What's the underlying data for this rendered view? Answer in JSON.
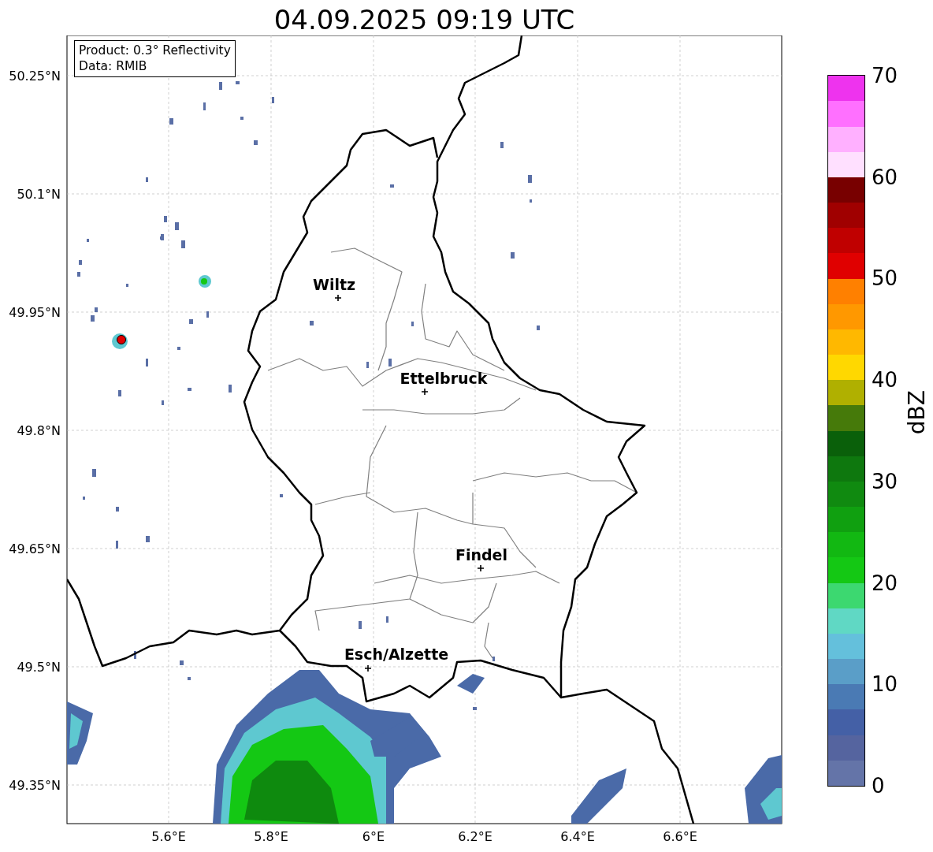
{
  "title": "04.09.2025 09:19 UTC",
  "info_box": [
    "Product: 0.3° Reflectivity",
    "Data: RMIB"
  ],
  "lat_ticks": [
    "50.25°N",
    "50.1°N",
    "49.95°N",
    "49.8°N",
    "49.65°N",
    "49.5°N",
    "49.35°N"
  ],
  "lon_ticks": [
    "5.6°E",
    "5.8°E",
    "6°E",
    "6.2°E",
    "6.4°E",
    "6.6°E"
  ],
  "cities": [
    {
      "name": "Wiltz"
    },
    {
      "name": "Ettelbruck"
    },
    {
      "name": "Findel"
    },
    {
      "name": "Esch/Alzette"
    }
  ],
  "colorbar": {
    "label": "dBZ",
    "ticks": [
      "70",
      "60",
      "50",
      "40",
      "30",
      "20",
      "10",
      "0"
    ],
    "segments": [
      {
        "color": "#6474a8"
      },
      {
        "color": "#55649f"
      },
      {
        "color": "#4460a6"
      },
      {
        "color": "#4a7ab4"
      },
      {
        "color": "#5a9ec8"
      },
      {
        "color": "#64c0dc"
      },
      {
        "color": "#60d8c4"
      },
      {
        "color": "#3cd870"
      },
      {
        "color": "#14c814"
      },
      {
        "color": "#12b812"
      },
      {
        "color": "#10a010"
      },
      {
        "color": "#108a10"
      },
      {
        "color": "#0e780e"
      },
      {
        "color": "#0a600a"
      },
      {
        "color": "#467a0a"
      },
      {
        "color": "#b0b000"
      },
      {
        "color": "#ffd800"
      },
      {
        "color": "#ffb800"
      },
      {
        "color": "#ff9800"
      },
      {
        "color": "#ff8000"
      },
      {
        "color": "#e00000"
      },
      {
        "color": "#c00000"
      },
      {
        "color": "#a00000"
      },
      {
        "color": "#780000"
      },
      {
        "color": "#ffe0ff"
      },
      {
        "color": "#ffb0ff"
      },
      {
        "color": "#ff70ff"
      },
      {
        "color": "#ee33ee"
      }
    ]
  }
}
